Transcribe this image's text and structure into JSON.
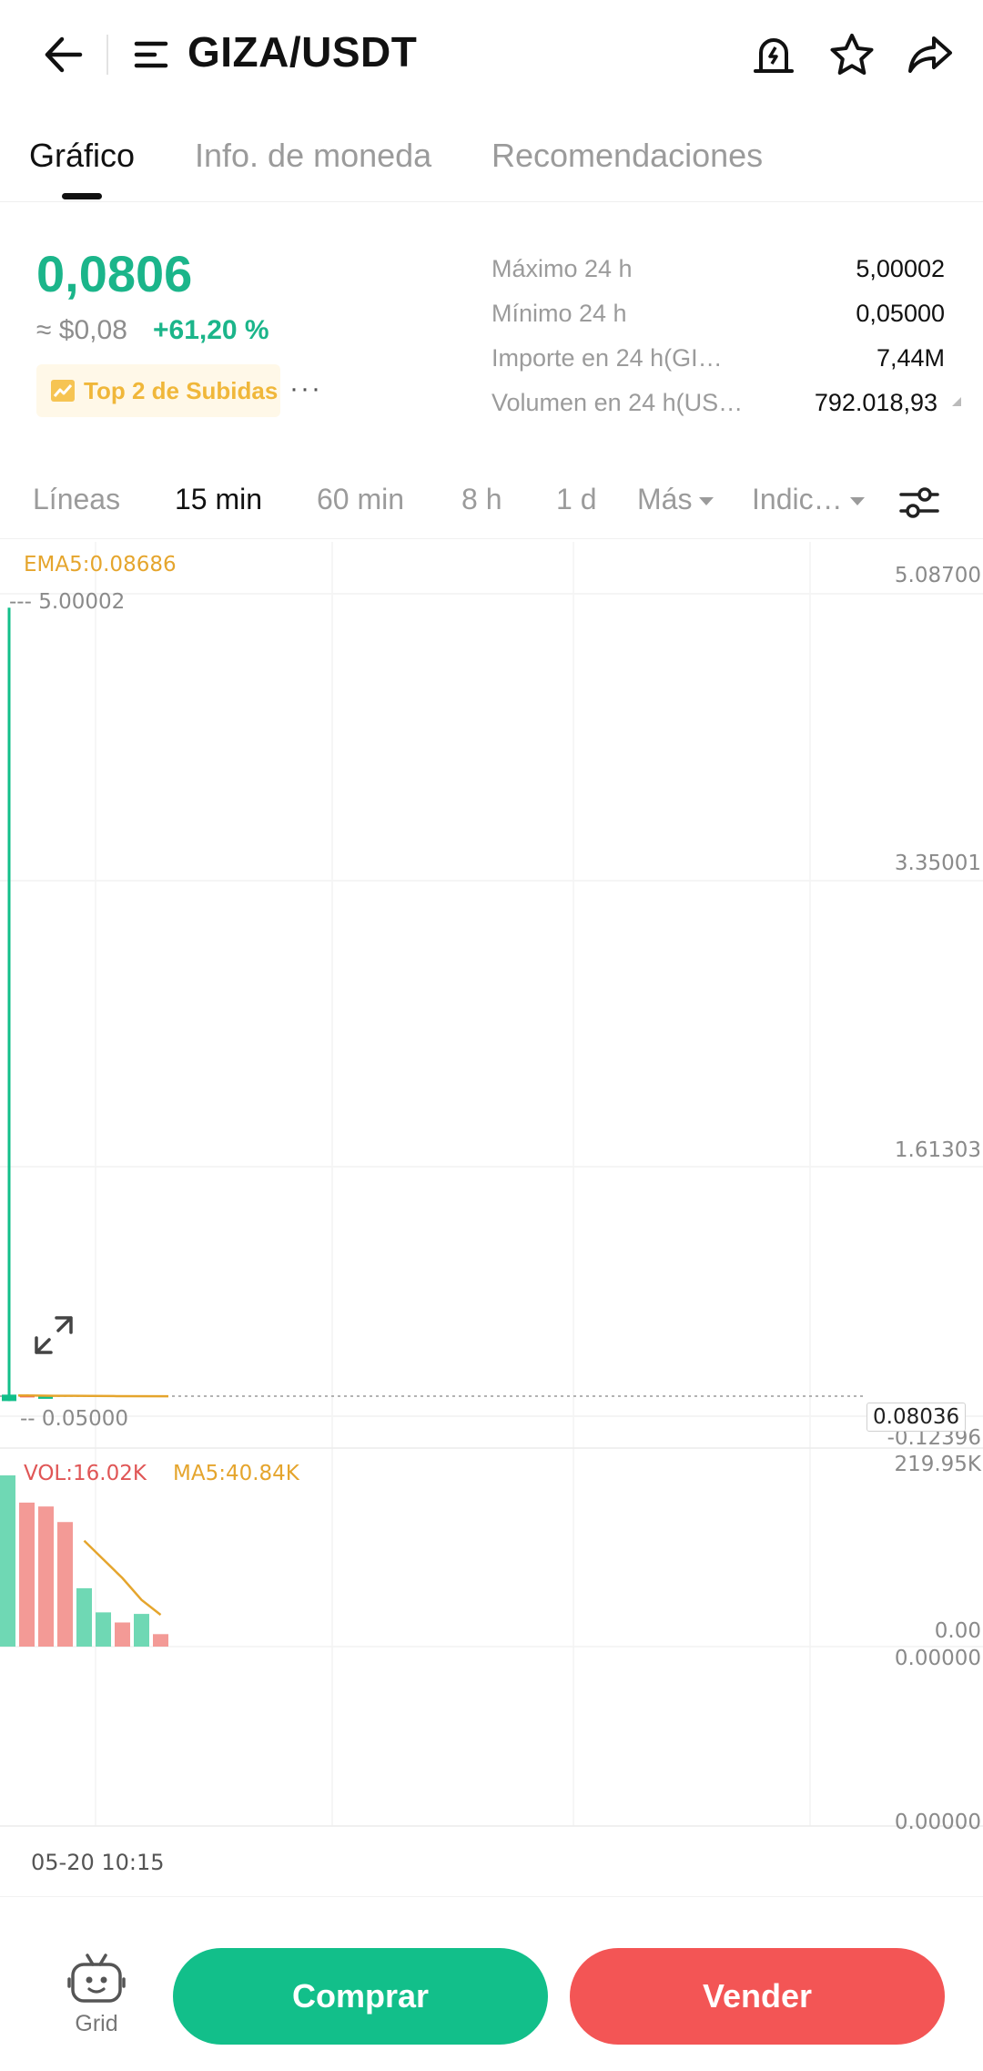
{
  "header": {
    "pair": "GIZA/USDT"
  },
  "tabs": [
    "Gráfico",
    "Info. de moneda",
    "Recomendaciones"
  ],
  "ticker": {
    "price": "0,0806",
    "approx_usd": "≈ $0,08",
    "change_pct": "+61,20 %",
    "badge": "Top 2 de Subidas",
    "more": "···",
    "stats": [
      {
        "label": "Máximo 24 h",
        "value": "5,00002"
      },
      {
        "label": "Mínimo 24 h",
        "value": "0,05000"
      },
      {
        "label": "Importe en 24 h(GI…",
        "value": "7,44M"
      },
      {
        "label": "Volumen en 24 h(US…",
        "value": "792.018,93"
      }
    ]
  },
  "intervals": [
    "Líneas",
    "15 min",
    "60 min",
    "8 h",
    "1 d",
    "Más",
    "Indic…"
  ],
  "chart": {
    "ema_label": "EMA5:0.08686",
    "max_marker": "--- 5.00002",
    "min_marker": "-- 0.05000",
    "price_axis": [
      "5.08700",
      "3.35001",
      "1.61303",
      "-0.12396"
    ],
    "current_price": "0.08036",
    "vol_label": "VOL:16.02K",
    "vol_ma_label": "MA5:40.84K",
    "vol_axis": [
      "219.95K",
      "0.00"
    ],
    "ind_axis": [
      "0.00000",
      "0.00000"
    ],
    "time_label": "05-20 10:15"
  },
  "chart_data": {
    "type": "bar",
    "title": "",
    "candles": [
      {
        "open": 0.05,
        "high": 5.00002,
        "low": 0.05,
        "close": 0.09,
        "direction": "up"
      },
      {
        "open": 0.09,
        "high": 0.092,
        "low": 0.075,
        "close": 0.08,
        "direction": "down"
      },
      {
        "open": 0.08,
        "high": 0.083,
        "low": 0.078,
        "close": 0.081,
        "direction": "up"
      }
    ],
    "ylim": [
      -0.12396,
      5.087
    ],
    "volume": {
      "ylim": [
        0,
        219950
      ],
      "bars": [
        {
          "value": 219950,
          "direction": "up"
        },
        {
          "value": 185000,
          "direction": "down"
        },
        {
          "value": 180000,
          "direction": "down"
        },
        {
          "value": 160000,
          "direction": "down"
        },
        {
          "value": 75000,
          "direction": "up"
        },
        {
          "value": 44000,
          "direction": "up"
        },
        {
          "value": 31000,
          "direction": "down"
        },
        {
          "value": 42000,
          "direction": "up"
        },
        {
          "value": 16020,
          "direction": "down"
        }
      ],
      "ma5": [
        null,
        null,
        null,
        null,
        136000,
        112000,
        88000,
        60000,
        40840
      ]
    }
  },
  "actions": {
    "grid": "Grid",
    "buy": "Comprar",
    "sell": "Vender"
  },
  "colors": {
    "up": "#12bf8a",
    "down": "#f35555",
    "ema": "#e5a52d",
    "accent_green": "#1bb58a"
  }
}
